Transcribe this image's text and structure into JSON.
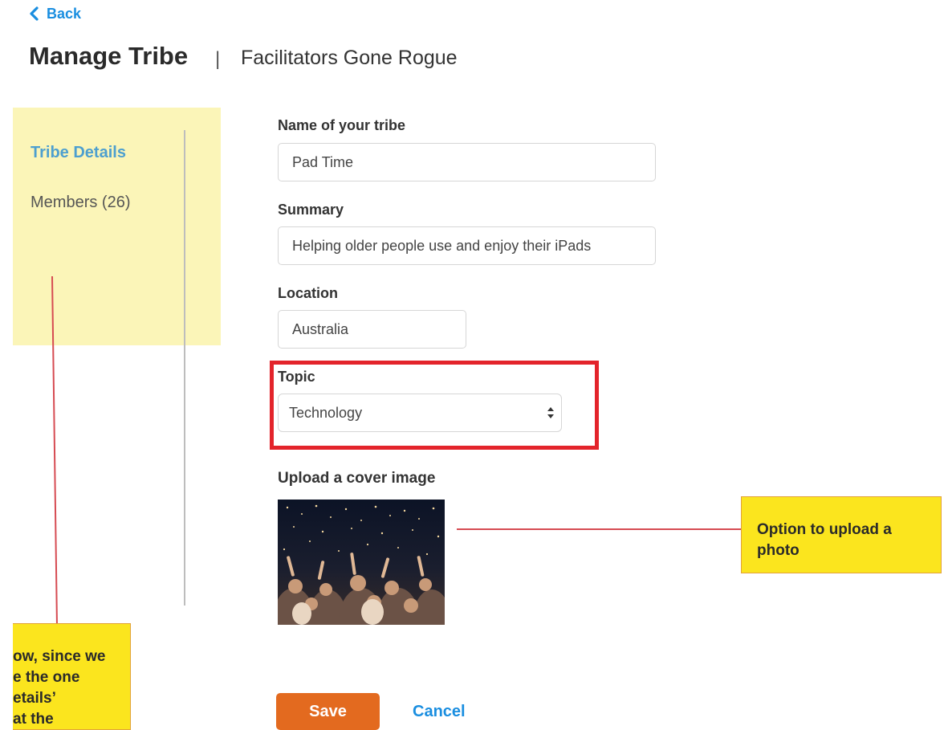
{
  "nav": {
    "back_label": "Back"
  },
  "header": {
    "title": "Manage Tribe",
    "separator": "|",
    "subtitle": "Facilitators Gone Rogue"
  },
  "sidebar": {
    "items": [
      {
        "label": "Tribe Details",
        "active": true
      },
      {
        "label": "Members (26)",
        "active": false
      }
    ]
  },
  "form": {
    "name": {
      "label": "Name of your tribe",
      "value": "Pad Time"
    },
    "summary": {
      "label": "Summary",
      "value": "Helping older people use and enjoy their iPads"
    },
    "location": {
      "label": "Location",
      "value": "Australia"
    },
    "topic": {
      "label": "Topic",
      "selected": "Technology"
    },
    "cover": {
      "label": "Upload a cover image"
    }
  },
  "actions": {
    "save_label": "Save",
    "cancel_label": "Cancel"
  },
  "annotations": {
    "upload_note": "Option to upload a photo",
    "left_note_lines": [
      "ow, since we",
      "e the one",
      "etails’",
      "at the"
    ]
  },
  "colors": {
    "link": "#1a8ee0",
    "sidebar_bg": "#fbf5b8",
    "sidebar_active": "#4d9fcf",
    "save_button": "#e36a1f",
    "highlight_box": "#e3242b",
    "note_bg": "#fbe51e",
    "note_line": "#d64b52"
  },
  "icons": {
    "back": "chevron-left-icon",
    "select": "updown-arrows-icon"
  }
}
